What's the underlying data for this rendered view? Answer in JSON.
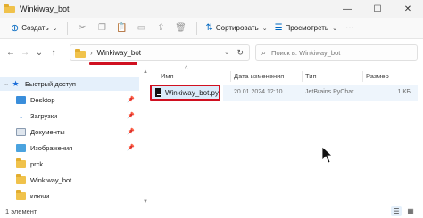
{
  "window": {
    "title": "Winkiway_bot",
    "controls": {
      "minimize": "—",
      "maximize": "☐",
      "close": "✕"
    }
  },
  "toolbar": {
    "new_label": "Создать",
    "sort_label": "Сортировать",
    "view_label": "Просмотреть",
    "more": "···",
    "icons": [
      "cut-icon",
      "copy-icon",
      "paste-icon",
      "rename-icon",
      "share-icon",
      "delete-icon"
    ]
  },
  "address": {
    "crumb": "Winkiway_bot",
    "separator": "›"
  },
  "search": {
    "placeholder": "Поиск в: Winkiway_bot"
  },
  "sidebar": {
    "items": [
      {
        "label": "Быстрый доступ",
        "icon": "star-icon",
        "pinned": false
      },
      {
        "label": "Desktop",
        "icon": "desktop-icon",
        "pinned": true
      },
      {
        "label": "Загрузки",
        "icon": "download-icon",
        "pinned": true
      },
      {
        "label": "Документы",
        "icon": "documents-icon",
        "pinned": true
      },
      {
        "label": "Изображения",
        "icon": "pictures-icon",
        "pinned": true
      },
      {
        "label": "prck",
        "icon": "folder-icon",
        "pinned": false
      },
      {
        "label": "Winkiway_bot",
        "icon": "folder-icon",
        "pinned": false
      },
      {
        "label": "ключи",
        "icon": "folder-icon",
        "pinned": false
      }
    ]
  },
  "columns": {
    "name": "Имя",
    "date": "Дата изменения",
    "type": "Тип",
    "size": "Размер"
  },
  "files": [
    {
      "name": "Winkiway_bot.py",
      "date": "20.01.2024 12:10",
      "type": "JetBrains PyChar...",
      "size": "1 КБ"
    }
  ],
  "status": {
    "count": "1 элемент"
  },
  "colors": {
    "accent": "#0067c0",
    "highlight_red": "#d01020",
    "selection": "#dcecfb"
  }
}
